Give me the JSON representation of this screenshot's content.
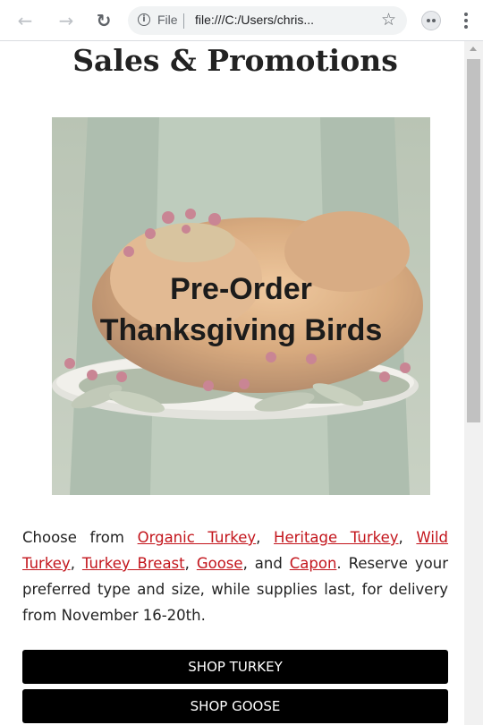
{
  "browser": {
    "scheme_label": "File",
    "url": "file:///C:/Users/chris...",
    "icons": [
      "back-icon",
      "forward-icon",
      "reload-icon",
      "info-icon",
      "star-icon",
      "extension-icon",
      "menu-icon"
    ]
  },
  "page": {
    "title": "Sales & Promotions",
    "hero": {
      "line1": "Pre-Order",
      "line2": "Thanksgiving Birds"
    },
    "description": {
      "intro": "Choose from ",
      "links": [
        "Organic Turkey",
        "Heritage Turkey",
        "Wild Turkey",
        "Turkey Breast",
        "Goose",
        "Capon"
      ],
      "sep": ", ",
      "and": ", and ",
      "outro": ". Reserve your preferred type and size, while supplies last, for delivery from November 16-20th."
    },
    "buttons": {
      "shop_turkey": "SHOP TURKEY",
      "shop_goose": "SHOP GOOSE"
    }
  },
  "colors": {
    "link": "#c3151c",
    "button_bg": "#000000",
    "button_text": "#ffffff"
  }
}
